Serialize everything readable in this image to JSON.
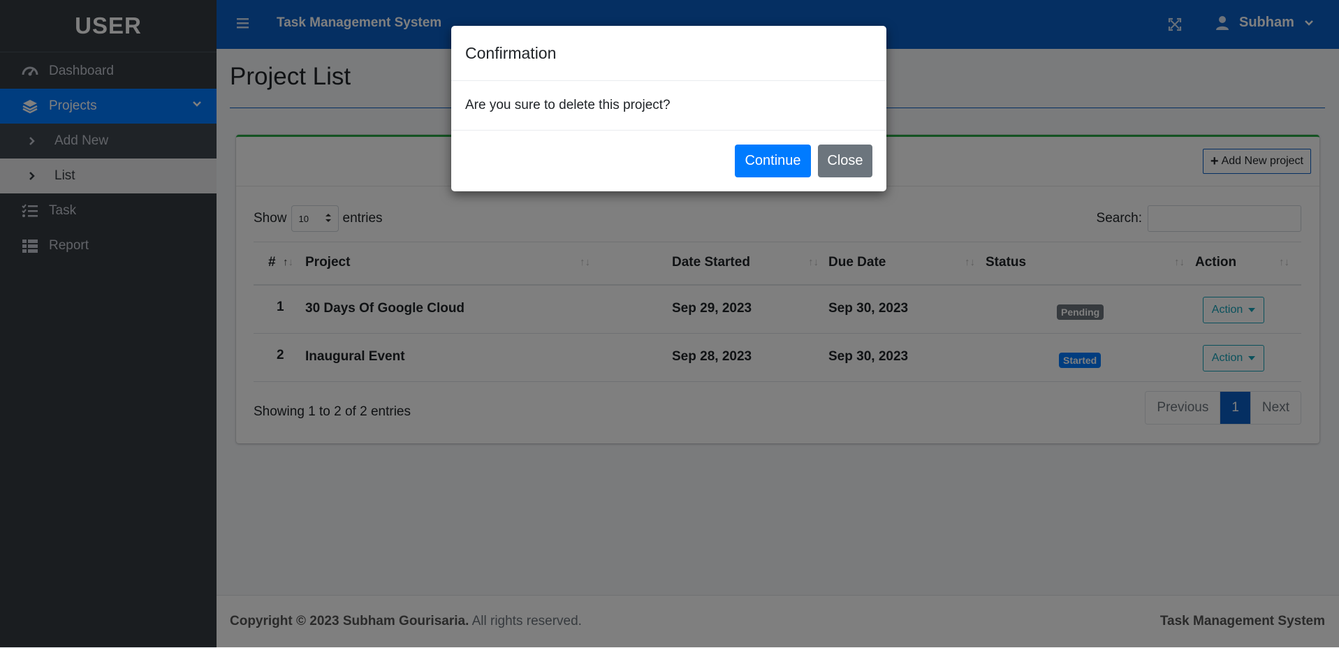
{
  "sidebar": {
    "brand": "USER",
    "items": [
      {
        "label": "Dashboard",
        "icon": "gauge-icon"
      },
      {
        "label": "Projects",
        "icon": "layers-icon"
      },
      {
        "label": "Task",
        "icon": "tasks-icon"
      },
      {
        "label": "Report",
        "icon": "table-icon"
      }
    ],
    "subitems": [
      {
        "label": "Add New"
      },
      {
        "label": "List"
      }
    ]
  },
  "topbar": {
    "title": "Task Management System",
    "user": "Subham"
  },
  "page": {
    "title": "Project List",
    "add_button": "Add New project",
    "show_label": "Show",
    "entries_value": "10",
    "entries_label": "entries",
    "search_label": "Search:",
    "search_value": ""
  },
  "table": {
    "headers": [
      "#",
      "Project",
      "Date Started",
      "Due Date",
      "Status",
      "Action"
    ],
    "rows": [
      {
        "num": "1",
        "project": "30 Days Of Google Cloud",
        "started": "Sep 29, 2023",
        "due": "Sep 30, 2023",
        "status": "Pending",
        "action": "Action"
      },
      {
        "num": "2",
        "project": "Inaugural Event",
        "started": "Sep 28, 2023",
        "due": "Sep 30, 2023",
        "status": "Started",
        "action": "Action"
      }
    ],
    "info": "Showing 1 to 2 of 2 entries",
    "pagination": {
      "previous": "Previous",
      "current": "1",
      "next": "Next"
    }
  },
  "footer": {
    "copyright_bold": "Copyright © 2023 Subham Gourisaria.",
    "copyright_rest": " All rights reserved.",
    "right": "Task Management System"
  },
  "modal": {
    "title": "Confirmation",
    "message": "Are you sure to delete this project?",
    "continue_label": "Continue",
    "close_label": "Close"
  },
  "colors": {
    "primary": "#007bff",
    "topbar": "#0a5ec4",
    "sidebar": "#343a40",
    "card_accent": "#28a745",
    "action": "#17a2b8",
    "secondary": "#6c757d"
  }
}
